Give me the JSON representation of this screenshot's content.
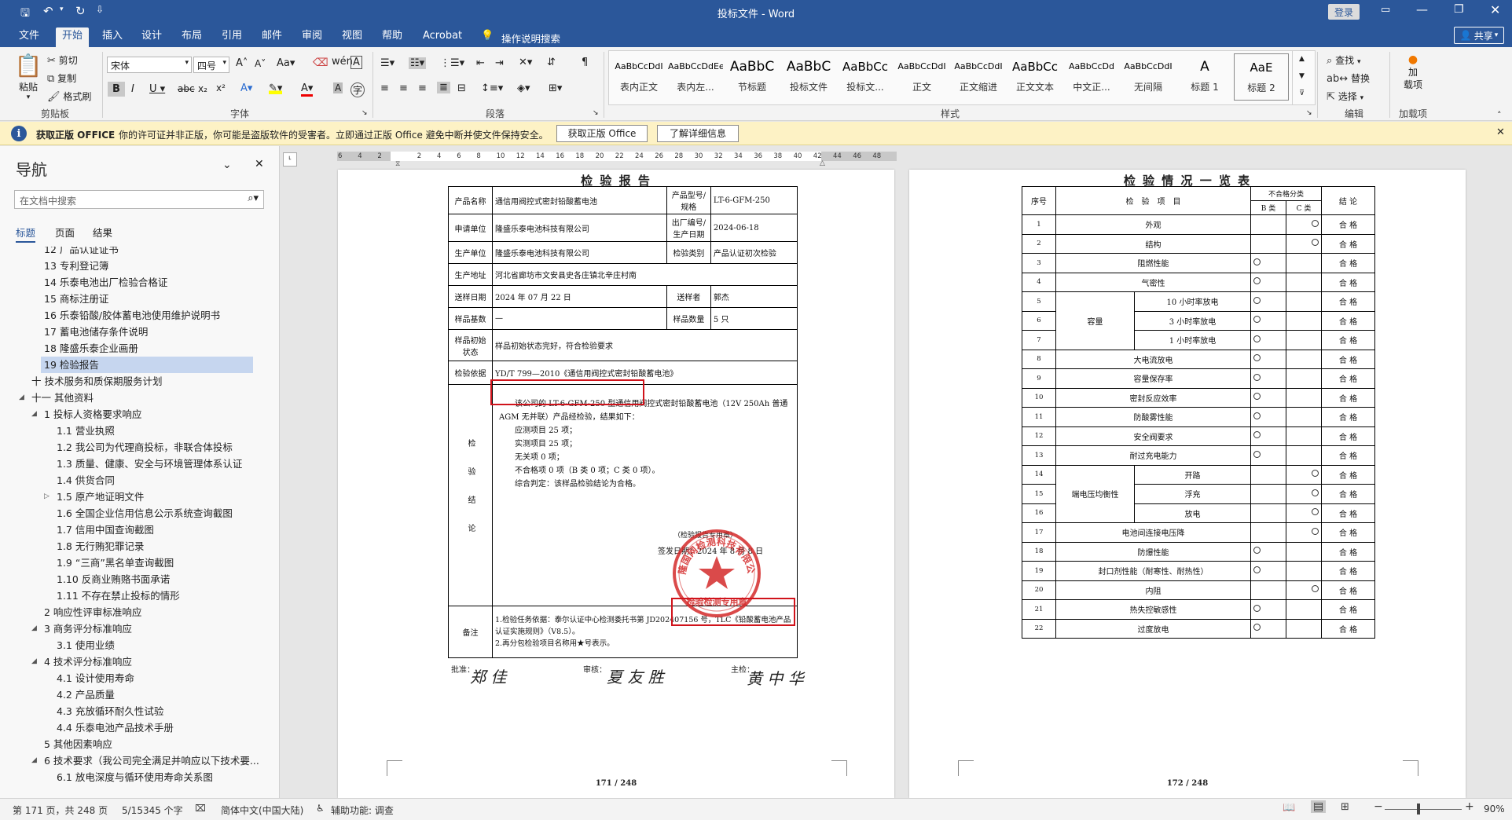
{
  "window": {
    "title": "投标文件 - Word",
    "login": "登录",
    "share": "共享"
  },
  "tabs": [
    "文件",
    "开始",
    "插入",
    "设计",
    "布局",
    "引用",
    "邮件",
    "审阅",
    "视图",
    "帮助",
    "Acrobat"
  ],
  "tell_me": "操作说明搜索",
  "ribbon": {
    "paste": "粘贴",
    "cut": "剪切",
    "copy": "复制",
    "format_painter": "格式刷",
    "clipboard_label": "剪贴板",
    "font_name": "宋体",
    "font_size": "四号",
    "font_label": "字体",
    "paragraph_label": "段落",
    "styles_label": "样式",
    "editing_label": "编辑",
    "addins_label": "加载项",
    "find": "查找",
    "replace": "替换",
    "select": "选择",
    "addin_btn": "加\n载项",
    "styles": [
      {
        "preview": "AaBbCcDdI",
        "name": "表内正文"
      },
      {
        "preview": "AaBbCcDdEe",
        "name": "表内左..."
      },
      {
        "preview": "AaBbC",
        "name": "节标题"
      },
      {
        "preview": "AaBbC",
        "name": "投标文件"
      },
      {
        "preview": "AaBbCc",
        "name": "投标文..."
      },
      {
        "preview": "AaBbCcDdI",
        "name": "正文"
      },
      {
        "preview": "AaBbCcDdI",
        "name": "正文缩进"
      },
      {
        "preview": "AaBbCc",
        "name": "正文文本"
      },
      {
        "preview": "AaBbCcDd",
        "name": "中文正..."
      },
      {
        "preview": "AaBbCcDdI",
        "name": "无间隔"
      },
      {
        "preview": "A",
        "name": "标题 1"
      },
      {
        "preview": "AaE",
        "name": "标题 2"
      }
    ]
  },
  "message_bar": {
    "title": "获取正版 OFFICE",
    "text": "你的许可证并非正版，你可能是盗版软件的受害者。立即通过正版 Office 避免中断并使文件保持安全。",
    "btn_get": "获取正版 Office",
    "btn_more": "了解详细信息"
  },
  "nav": {
    "title": "导航",
    "search_placeholder": "在文档中搜索",
    "tabs": [
      "标题",
      "页面",
      "结果"
    ],
    "items": [
      {
        "text": "12 广品认证证书",
        "level": 2
      },
      {
        "text": "13 专利登记簿",
        "level": 2
      },
      {
        "text": "14 乐泰电池出厂检验合格证",
        "level": 2
      },
      {
        "text": "15 商标注册证",
        "level": 2
      },
      {
        "text": "16 乐泰铅酸/胶体蓄电池使用维护说明书",
        "level": 2
      },
      {
        "text": "17 蓄电池储存条件说明",
        "level": 2
      },
      {
        "text": "18 隆盛乐泰企业画册",
        "level": 2
      },
      {
        "text": "19 检验报告",
        "level": 2,
        "selected": true
      },
      {
        "text": "十 技术服务和质保期服务计划",
        "level": 1
      },
      {
        "text": "十一 其他资料",
        "level": 1,
        "expanded": true
      },
      {
        "text": "1 投标人资格要求响应",
        "level": 2,
        "expanded": true
      },
      {
        "text": "1.1 营业执照",
        "level": 3
      },
      {
        "text": "1.2 我公司为代理商投标，非联合体投标",
        "level": 3
      },
      {
        "text": "1.3 质量、健康、安全与环境管理体系认证",
        "level": 3
      },
      {
        "text": "1.4 供货合同",
        "level": 3
      },
      {
        "text": "1.5 原产地证明文件",
        "level": 3,
        "collapsed": true
      },
      {
        "text": "1.6 全国企业信用信息公示系统查询截图",
        "level": 3
      },
      {
        "text": "1.7 信用中国查询截图",
        "level": 3
      },
      {
        "text": "1.8 无行贿犯罪记录",
        "level": 3
      },
      {
        "text": "1.9 “三商”黑名单查询截图",
        "level": 3
      },
      {
        "text": "1.10 反商业贿赂书面承诺",
        "level": 3
      },
      {
        "text": "1.11 不存在禁止投标的情形",
        "level": 3
      },
      {
        "text": "2 响应性评审标准响应",
        "level": 2
      },
      {
        "text": "3 商务评分标准响应",
        "level": 2,
        "expanded": true
      },
      {
        "text": "3.1 使用业绩",
        "level": 3
      },
      {
        "text": "4 技术评分标准响应",
        "level": 2,
        "expanded": true
      },
      {
        "text": "4.1 设计使用寿命",
        "level": 3
      },
      {
        "text": "4.2 产品质量",
        "level": 3
      },
      {
        "text": "4.3 充放循环耐久性试验",
        "level": 3
      },
      {
        "text": "4.4 乐泰电池产品技术手册",
        "level": 3
      },
      {
        "text": "5 其他因素响应",
        "level": 2
      },
      {
        "text": "6 技术要求（我公司完全满足并响应以下技术要...",
        "level": 2,
        "expanded": true
      },
      {
        "text": "6.1 放电深度与循环使用寿命关系图",
        "level": 3
      }
    ]
  },
  "ruler": [
    "6",
    "4",
    "2",
    "",
    "2",
    "4",
    "6",
    "8",
    "10",
    "12",
    "14",
    "16",
    "18",
    "20",
    "22",
    "24",
    "26",
    "28",
    "30",
    "32",
    "34",
    "36",
    "38",
    "40",
    "42",
    "44",
    "46",
    "48"
  ],
  "page1": {
    "title": "检 验 报 告",
    "rows": {
      "product_name_l": "产品名称",
      "product_name": "通信用阀控式密封铅酸蓄电池",
      "model_l": "产品型号/规格",
      "model": "LT-6-GFM-250",
      "applicant_l": "申请单位",
      "applicant": "隆盛乐泰电池科技有限公司",
      "factory_no_l": "出厂编号/生产日期",
      "factory_no": "2024-06-18",
      "producer_l": "生产单位",
      "producer": "隆盛乐泰电池科技有限公司",
      "type_l": "检验类别",
      "type": "产品认证初次检验",
      "addr_l": "生产地址",
      "addr": "河北省廊坊市文安县史各庄镇北辛庄村南",
      "send_date_l": "送样日期",
      "send_date": "2024 年 07 月 22 日",
      "sender_l": "送样者",
      "sender": "郭杰",
      "base_l": "样品基数",
      "base": "—",
      "qty_l": "样品数量",
      "qty": "5 只",
      "state_l": "样品初始状态",
      "state": "样品初始状态完好，符合检验要求",
      "basis_l": "检验依据",
      "basis": "YD/T 799—2010《通信用阀控式密封铅酸蓄电池》",
      "conclusion_l": "检验结论",
      "conclusion": [
        "该公司的 LT-6-GFM-250 型通信用阀控式密封铅酸蓄电池（12V 250Ah 普通 AGM 无并联）产品经检验，结果如下：",
        "应测项目 25 项；",
        "实测项目 25 项；",
        "无关项 0 项；",
        "不合格项 0 项（B 类 0 项；C 类 0 项）。",
        "综合判定：该样品检验结论为合格。"
      ],
      "sign_text": "（检验报告专用章）",
      "sign_date": "签发日期：2024 年 8 月 8 日",
      "note_l": "备注",
      "note": "1.检验任务依据：泰尔认证中心检测委托书第 JD202407156 号，TLC《铅酸蓄电池产品认证实施规则》（V8.5）。\n2.再分包检验项目名称用★号表示。"
    },
    "footer": {
      "approve": "批准：",
      "review": "审核：",
      "main": "主检："
    },
    "stamp_text": "检验检测专用章",
    "stamp_ring": "隆国网检测科技有限公司",
    "page_no": "171 / 248"
  },
  "page2": {
    "title": "检 验 情 况 一 览 表",
    "headers": {
      "no": "序号",
      "item": "检　验　项　目",
      "nc": "不合格分类",
      "b": "B 类",
      "c": "C 类",
      "result": "结 论"
    },
    "rows": [
      {
        "no": "1",
        "item": "外观",
        "sub": "",
        "cls": "C",
        "r": "合 格"
      },
      {
        "no": "2",
        "item": "结构",
        "sub": "",
        "cls": "C",
        "r": "合 格"
      },
      {
        "no": "3",
        "item": "阻燃性能",
        "sub": "",
        "cls": "B",
        "r": "合 格"
      },
      {
        "no": "4",
        "item": "气密性",
        "sub": "",
        "cls": "B",
        "r": "合 格"
      },
      {
        "no": "5",
        "item": "容量",
        "sub": "10 小时率放电",
        "cls": "B",
        "r": "合 格"
      },
      {
        "no": "6",
        "item": "",
        "sub": "3 小时率放电",
        "cls": "B",
        "r": "合 格"
      },
      {
        "no": "7",
        "item": "",
        "sub": "1 小时率放电",
        "cls": "B",
        "r": "合 格"
      },
      {
        "no": "8",
        "item": "大电流放电",
        "sub": "",
        "cls": "B",
        "r": "合 格"
      },
      {
        "no": "9",
        "item": "容量保存率",
        "sub": "",
        "cls": "B",
        "r": "合 格"
      },
      {
        "no": "10",
        "item": "密封反应效率",
        "sub": "",
        "cls": "B",
        "r": "合 格"
      },
      {
        "no": "11",
        "item": "防酸雾性能",
        "sub": "",
        "cls": "B",
        "r": "合 格"
      },
      {
        "no": "12",
        "item": "安全阀要求",
        "sub": "",
        "cls": "B",
        "r": "合 格"
      },
      {
        "no": "13",
        "item": "耐过充电能力",
        "sub": "",
        "cls": "B",
        "r": "合 格"
      },
      {
        "no": "14",
        "item": "端电压均衡性",
        "sub": "开路",
        "cls": "C",
        "r": "合 格"
      },
      {
        "no": "15",
        "item": "",
        "sub": "浮充",
        "cls": "C",
        "r": "合 格"
      },
      {
        "no": "16",
        "item": "",
        "sub": "放电",
        "cls": "C",
        "r": "合 格"
      },
      {
        "no": "17",
        "item": "电池间连接电压降",
        "sub": "",
        "cls": "C",
        "r": "合 格"
      },
      {
        "no": "18",
        "item": "防爆性能",
        "sub": "",
        "cls": "B",
        "r": "合 格"
      },
      {
        "no": "19",
        "item": "封口剂性能（耐寒性、耐热性）",
        "sub": "",
        "cls": "B",
        "r": "合 格"
      },
      {
        "no": "20",
        "item": "内阻",
        "sub": "",
        "cls": "C",
        "r": "合 格"
      },
      {
        "no": "21",
        "item": "热失控敏感性",
        "sub": "",
        "cls": "B",
        "r": "合 格"
      },
      {
        "no": "22",
        "item": "过度放电",
        "sub": "",
        "cls": "B",
        "r": "合 格"
      }
    ],
    "page_no": "172 / 248"
  },
  "statusbar": {
    "page": "第 171 页，共 248 页",
    "words": "5/15345 个字",
    "lang": "简体中文(中国大陆)",
    "accessibility": "辅助功能: 调查",
    "zoom": "90%"
  },
  "colors": {
    "accent": "#2b579a",
    "redbox": "#d0131b",
    "stamp": "#d42a2a"
  }
}
